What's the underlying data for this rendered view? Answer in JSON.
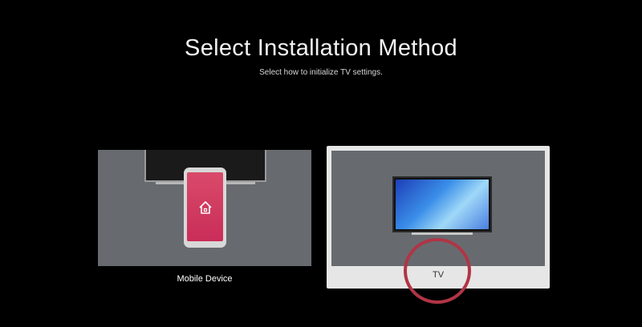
{
  "screen": {
    "title": "Select Installation Method",
    "subtitle": "Select how to initialize TV settings."
  },
  "options": [
    {
      "label": "Mobile Device",
      "icon": "mobile-device-icon",
      "selected": false
    },
    {
      "label": "TV",
      "icon": "tv-icon",
      "selected": true
    }
  ],
  "colors": {
    "background": "#000000",
    "card_art": "#676b70",
    "selected_frame": "#e6e6e6",
    "phone_screen": "#c92d58",
    "annotation_circle": "#b03545"
  }
}
